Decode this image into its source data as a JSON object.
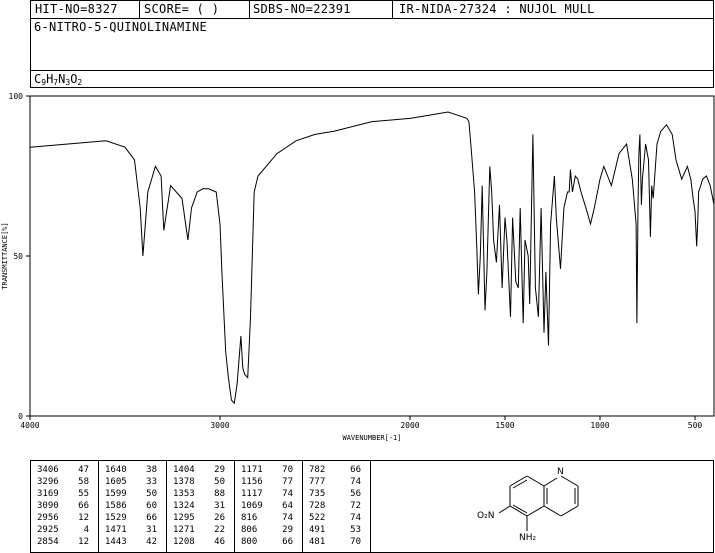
{
  "header": {
    "hit_no": "HIT-NO=8327",
    "score": "SCORE=  (   )",
    "sdbs_no": "SDBS-NO=22391",
    "ir_code": "IR-NIDA-27324 : NUJOL MULL",
    "compound_name": "6-NITRO-5-QUINOLINAMINE",
    "formula": {
      "C": "C",
      "c_n": "9",
      "H": "H",
      "h_n": "7",
      "N": "N",
      "n_n": "3",
      "O": "O",
      "o_n": "2"
    }
  },
  "chart_data": {
    "type": "line",
    "xlabel": "WAVENUMBER[-1]",
    "ylabel": "TRANSMITTANCE[%]",
    "xlim": [
      4000,
      400
    ],
    "ylim": [
      0,
      100
    ],
    "x_ticks": [
      4000,
      3000,
      2000,
      1500,
      1000,
      500
    ],
    "y_ticks": [
      0,
      50,
      100
    ],
    "x": [
      4000,
      3800,
      3600,
      3500,
      3450,
      3420,
      3406,
      3380,
      3340,
      3310,
      3296,
      3260,
      3230,
      3200,
      3169,
      3150,
      3120,
      3090,
      3060,
      3020,
      3000,
      2990,
      2970,
      2956,
      2940,
      2925,
      2910,
      2890,
      2880,
      2870,
      2854,
      2840,
      2820,
      2800,
      2700,
      2600,
      2500,
      2400,
      2200,
      2000,
      1900,
      1800,
      1750,
      1700,
      1690,
      1680,
      1660,
      1650,
      1640,
      1630,
      1620,
      1605,
      1595,
      1580,
      1570,
      1560,
      1545,
      1529,
      1515,
      1500,
      1490,
      1471,
      1460,
      1443,
      1430,
      1420,
      1404,
      1395,
      1378,
      1370,
      1353,
      1340,
      1324,
      1310,
      1295,
      1285,
      1271,
      1260,
      1240,
      1230,
      1208,
      1190,
      1171,
      1162,
      1156,
      1145,
      1130,
      1117,
      1100,
      1069,
      1050,
      1030,
      1000,
      980,
      960,
      940,
      900,
      860,
      830,
      810,
      806,
      800,
      795,
      790,
      782,
      777,
      760,
      745,
      735,
      728,
      720,
      700,
      680,
      650,
      620,
      600,
      570,
      540,
      522,
      510,
      500,
      491,
      485,
      481,
      470,
      460,
      440,
      420,
      400
    ],
    "y": [
      84,
      85,
      86,
      84,
      80,
      65,
      50,
      70,
      78,
      75,
      58,
      72,
      70,
      68,
      55,
      65,
      70,
      71,
      71,
      70,
      60,
      45,
      20,
      12,
      5,
      4,
      10,
      25,
      15,
      13,
      12,
      30,
      70,
      75,
      82,
      86,
      88,
      89,
      92,
      93,
      94,
      95,
      94,
      93,
      92,
      85,
      70,
      55,
      38,
      50,
      72,
      33,
      45,
      78,
      70,
      55,
      48,
      66,
      40,
      62,
      55,
      31,
      62,
      42,
      40,
      65,
      29,
      55,
      50,
      35,
      88,
      40,
      31,
      65,
      26,
      45,
      22,
      60,
      75,
      62,
      46,
      65,
      70,
      70,
      77,
      70,
      75,
      74,
      70,
      64,
      60,
      65,
      74,
      78,
      75,
      72,
      82,
      85,
      74,
      60,
      29,
      66,
      82,
      88,
      66,
      74,
      85,
      80,
      56,
      72,
      68,
      85,
      89,
      91,
      88,
      80,
      74,
      78,
      74,
      68,
      64,
      53,
      62,
      70,
      72,
      74,
      75,
      72,
      66
    ]
  },
  "peak_table": {
    "columns": [
      [
        [
          "3406",
          "47"
        ],
        [
          "3296",
          "58"
        ],
        [
          "3169",
          "55"
        ],
        [
          "3090",
          "66"
        ],
        [
          "2956",
          "12"
        ],
        [
          "2925",
          "4"
        ],
        [
          "2854",
          "12"
        ]
      ],
      [
        [
          "1640",
          "38"
        ],
        [
          "1605",
          "33"
        ],
        [
          "1599",
          "50"
        ],
        [
          "1586",
          "60"
        ],
        [
          "1529",
          "66"
        ],
        [
          "1471",
          "31"
        ],
        [
          "1443",
          "42"
        ]
      ],
      [
        [
          "1404",
          "29"
        ],
        [
          "1378",
          "50"
        ],
        [
          "1353",
          "88"
        ],
        [
          "1324",
          "31"
        ],
        [
          "1295",
          "26"
        ],
        [
          "1271",
          "22"
        ],
        [
          "1208",
          "46"
        ]
      ],
      [
        [
          "1171",
          "70"
        ],
        [
          "1156",
          "77"
        ],
        [
          "1117",
          "74"
        ],
        [
          "1069",
          "64"
        ],
        [
          "816",
          "74"
        ],
        [
          "806",
          "29"
        ],
        [
          "800",
          "66"
        ]
      ],
      [
        [
          "782",
          "66"
        ],
        [
          "777",
          "74"
        ],
        [
          "735",
          "56"
        ],
        [
          "728",
          "72"
        ],
        [
          "522",
          "74"
        ],
        [
          "491",
          "53"
        ],
        [
          "481",
          "70"
        ]
      ]
    ]
  },
  "structure": {
    "n_ring": "N",
    "nitro": "O₂N",
    "amine": "NH₂"
  }
}
